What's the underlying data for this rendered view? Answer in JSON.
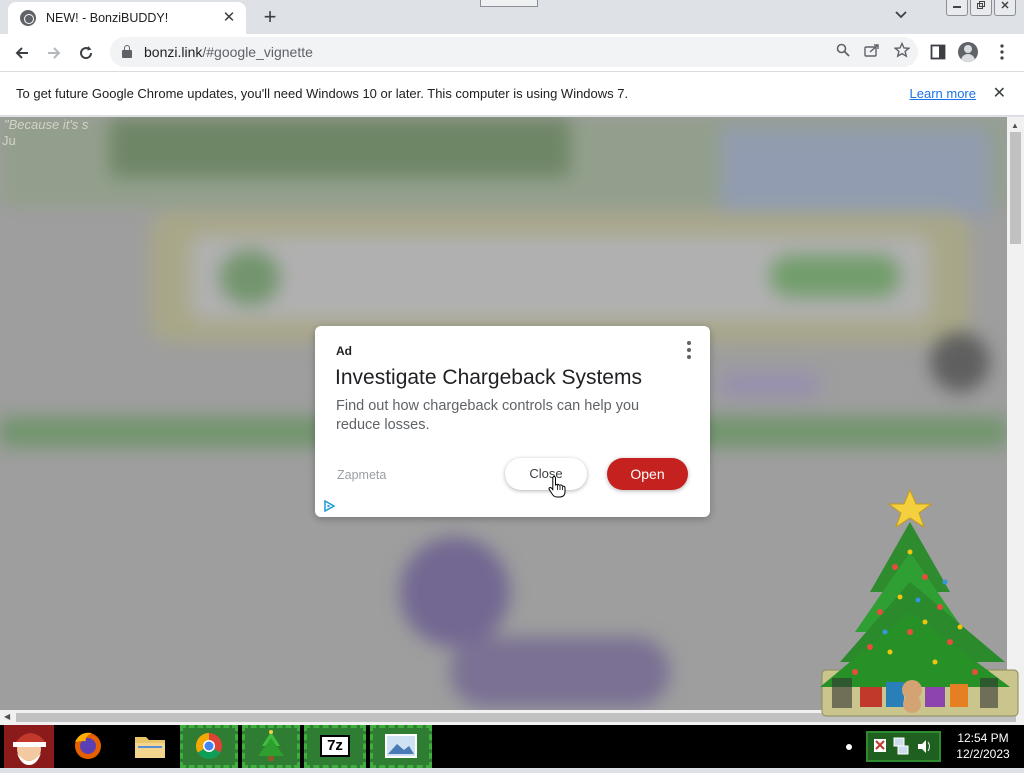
{
  "browser": {
    "tab": {
      "title": "NEW! - BonziBUDDY!",
      "favicon": "globe-icon"
    },
    "new_tab_symbol": "+",
    "url_host": "bonzi.link",
    "url_path": "/#google_vignette",
    "infobar": {
      "message": "To get future Google Chrome updates, you'll need Windows 10 or later. This computer is using Windows 7.",
      "link": "Learn more"
    }
  },
  "page_background": {
    "line1": "\"Because it's s",
    "line2": "Ju"
  },
  "ad": {
    "label": "Ad",
    "title": "Investigate Chargeback Systems",
    "description": "Find out how chargeback controls can help you reduce losses.",
    "advertiser": "Zapmeta",
    "close_label": "Close",
    "open_label": "Open",
    "open_color": "#c5221f"
  },
  "taskbar": {
    "apps": [
      "santa-icon",
      "firefox-icon",
      "explorer-icon",
      "chrome-icon",
      "christmas-tree-icon",
      "7zip-icon",
      "image-viewer-icon"
    ],
    "zip_label": "7z",
    "clock_time": "12:54 PM",
    "clock_date": "12/2/2023"
  },
  "desktop_widget": {
    "icon": "christmas-tree-icon"
  }
}
